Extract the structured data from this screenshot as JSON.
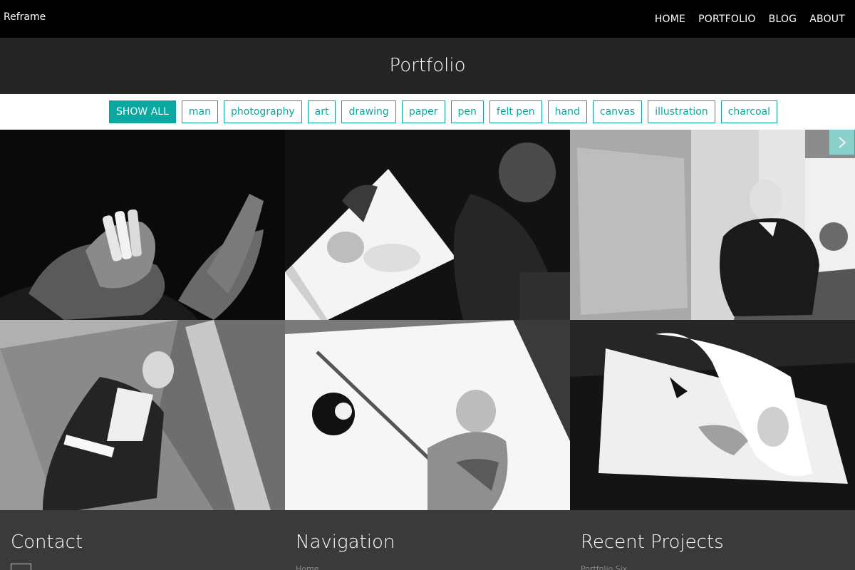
{
  "app": {
    "brand": "Reframe"
  },
  "nav": {
    "items": [
      "HOME",
      "PORTFOLIO",
      "BLOG",
      "ABOUT"
    ]
  },
  "header": {
    "title": "Portfolio"
  },
  "filters": [
    "SHOW ALL",
    "man",
    "photography",
    "art",
    "drawing",
    "paper",
    "pen",
    "felt pen",
    "hand",
    "canvas",
    "illustration",
    "charcoal"
  ],
  "active_filter": "SHOW ALL",
  "accent_color": "#0aa8a0",
  "gallery": {
    "tiles": [
      {
        "alt": "hands holding felt pens"
      },
      {
        "alt": "person sketching on paper"
      },
      {
        "alt": "man crouching by building"
      },
      {
        "alt": "man leaning on glass wall"
      },
      {
        "alt": "drawing of billiards player"
      },
      {
        "alt": "sketchbook page curling"
      }
    ],
    "next_icon": "chevron-right-icon"
  },
  "footer": {
    "contact": {
      "title": "Contact"
    },
    "navigation": {
      "title": "Navigation",
      "first_link": "Home"
    },
    "recent": {
      "title": "Recent Projects",
      "first_link": "Portfolio Six"
    }
  }
}
